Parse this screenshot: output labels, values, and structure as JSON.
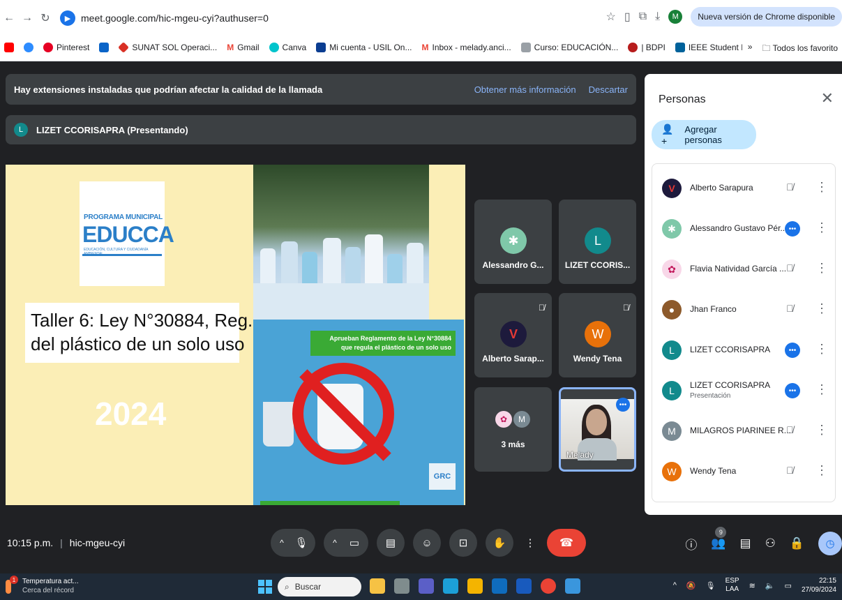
{
  "browser": {
    "url": "meet.google.com/hic-mgeu-cyi?authuser=0",
    "profile_initial": "M",
    "update_label": "Nueva versión de Chrome disponible",
    "bookmarks": [
      {
        "label": "Pinterest",
        "color": "#e60023"
      },
      {
        "label": "",
        "color": "#0a64c8"
      },
      {
        "label": "SUNAT SOL Operaci...",
        "color": "#d93025"
      },
      {
        "label": "Gmail",
        "color": "#ea4335"
      },
      {
        "label": "Canva",
        "color": "#00c4cc"
      },
      {
        "label": "Mi cuenta - USIL On...",
        "color": "#0b3d91"
      },
      {
        "label": "Inbox - melady.anci...",
        "color": "#ea4335"
      },
      {
        "label": "Curso: EDUCACIÓN...",
        "color": "#9aa0a6"
      },
      {
        "label": "| BDPI",
        "color": "#b71c1c"
      },
      {
        "label": "IEEE Student Branch...",
        "color": "#00629b"
      }
    ],
    "overflow": "»",
    "all_bookmarks": "Todos los favorito"
  },
  "banner": {
    "text": "Hay extensiones instaladas que podrían afectar la calidad de la llamada",
    "learn_more": "Obtener más información",
    "dismiss": "Descartar"
  },
  "presenting": {
    "initial": "L",
    "label": "LIZET CCORISAPRA (Presentando)"
  },
  "slide": {
    "logo_top": "PROGRAMA MUNICIPAL",
    "logo_main": "EDUCCA",
    "logo_bottom": "EDUCACIÓN, CULTURA Y CIUDADANÍA AMBIENTAL",
    "title_line1": "Taller 6: Ley N°30884, Reg.",
    "title_line2": "del plástico de un solo uso",
    "year": "2024",
    "poster_line1": "Aprueban Reglamento de la Ley N°30884",
    "poster_line2": "que regula el plástico de un solo uso",
    "poster_logo": "GRC"
  },
  "tiles": [
    {
      "name": "Alessandro G...",
      "initial": "",
      "color": "#7fc8a9",
      "muted": false
    },
    {
      "name": "LIZET CCORIS...",
      "initial": "L",
      "color": "#128a8c",
      "muted": false
    },
    {
      "name": "Alberto Sarap...",
      "initial": "",
      "color": "#1d1a3c",
      "muted": true
    },
    {
      "name": "Wendy Tena",
      "initial": "W",
      "color": "#e8710a",
      "muted": true
    },
    {
      "name": "3 más",
      "initial": "M",
      "color": "#7a8a93",
      "muted": false
    },
    {
      "name": "Melady",
      "initial": "",
      "color": "",
      "muted": false
    }
  ],
  "panel": {
    "title": "Personas",
    "add_people": "Agregar personas",
    "people": [
      {
        "name": "Alberto Sarapura",
        "sub": "",
        "initial": "",
        "color": "#1d1a3c",
        "state": "muted"
      },
      {
        "name": "Alessandro Gustavo Pér...",
        "sub": "",
        "initial": "",
        "color": "#7fc8a9",
        "state": "active"
      },
      {
        "name": "Flavia Natividad García ...",
        "sub": "",
        "initial": "",
        "color": "#f8d7e8",
        "state": "muted"
      },
      {
        "name": "Jhan Franco",
        "sub": "",
        "initial": "",
        "color": "#8d5a2b",
        "state": "muted"
      },
      {
        "name": "LIZET CCORISAPRA",
        "sub": "",
        "initial": "L",
        "color": "#128a8c",
        "state": "active"
      },
      {
        "name": "LIZET CCORISAPRA",
        "sub": "Presentación",
        "initial": "L",
        "color": "#128a8c",
        "state": "active"
      },
      {
        "name": "MILAGROS PIARINEE R...",
        "sub": "",
        "initial": "M",
        "color": "#7a8a93",
        "state": "muted"
      },
      {
        "name": "Wendy Tena",
        "sub": "",
        "initial": "W",
        "color": "#e8710a",
        "state": "muted"
      }
    ]
  },
  "controls": {
    "time": "10:15 p.m.",
    "meeting_code": "hic-mgeu-cyi",
    "participant_count": "9"
  },
  "taskbar": {
    "weather_badge": "1",
    "weather_line1": "Temperatura act...",
    "weather_line2": "Cerca del récord",
    "search": "Buscar",
    "lang1": "ESP",
    "lang2": "LAA",
    "time": "22:15",
    "date": "27/09/2024"
  }
}
